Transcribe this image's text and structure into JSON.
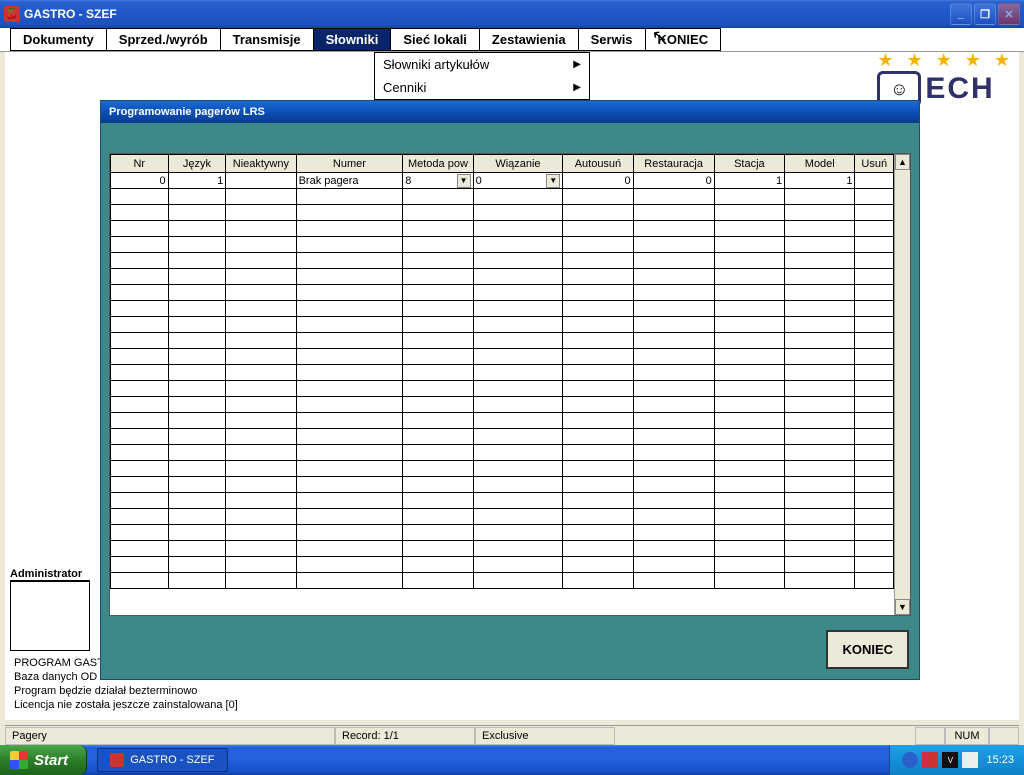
{
  "window": {
    "title": "GASTRO - SZEF"
  },
  "menu": {
    "items": [
      "Dokumenty",
      "Sprzed./wyrób",
      "Transmisje",
      "Słowniki",
      "Sieć lokali",
      "Zestawienia",
      "Serwis",
      "KONIEC"
    ],
    "active_index": 3,
    "dropdown": [
      "Słowniki artykułów",
      "Cenniki"
    ]
  },
  "logo": {
    "stars": "★ ★ ★ ★ ★",
    "text": "ECH",
    "face": "☺"
  },
  "inner": {
    "title": "Programowanie pagerów LRS",
    "columns": [
      "Nr",
      "Język",
      "Nieaktywny",
      "Numer",
      "Metoda pow",
      "Wiązanie",
      "Autousuń",
      "Restauracja",
      "Stacja",
      "Model",
      "Usuń"
    ],
    "row": {
      "nr": "0",
      "jezyk": "1",
      "nieaktywny": "",
      "numer": "Brak pagera",
      "metoda": "8",
      "wiazanie": "0",
      "autousun": "0",
      "restauracja": "0",
      "stacja": "1",
      "model": "1",
      "usun": ""
    },
    "button": "KONIEC"
  },
  "admin": {
    "label": "Administrator"
  },
  "bottom": {
    "l1": "PROGRAM GAST",
    "l2": "Baza danych OD",
    "l3": "Program będzie działał bezterminowo",
    "l4": "Licencja nie została jeszcze zainstalowana [0]"
  },
  "status": {
    "left": "Pagery",
    "record": "Record: 1/1",
    "mode": "Exclusive",
    "num": "NUM"
  },
  "taskbar": {
    "start": "Start",
    "app": "GASTRO - SZEF",
    "clock": "15:23"
  }
}
